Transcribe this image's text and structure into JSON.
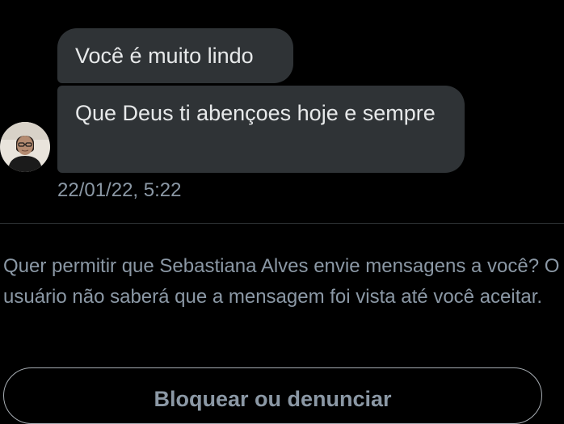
{
  "conversation": {
    "messages": [
      {
        "text": "Você é muito lindo"
      },
      {
        "text": "Que Deus ti abençoes hoje e sempre"
      }
    ],
    "timestamp": "22/01/22, 5:22"
  },
  "request": {
    "prompt": "Quer permitir que Sebastiana Alves envie mensagens a você? O usuário não saberá que a mensagem foi vista até você aceitar.",
    "block_label": "Bloquear ou denunciar"
  },
  "colors": {
    "background": "#000000",
    "bubble": "#2f3336",
    "primary_text": "#e7e9ea",
    "secondary_text": "#8b98a5"
  }
}
